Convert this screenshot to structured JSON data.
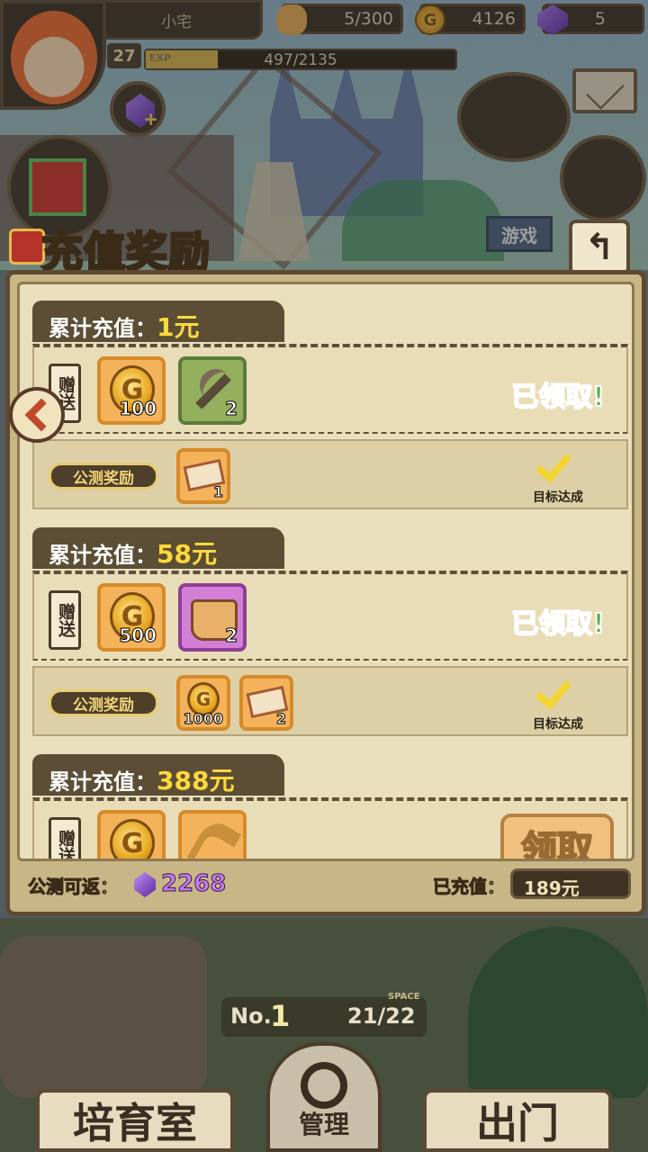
{
  "hud": {
    "player_name": "小宅",
    "level": "27",
    "exp_label": "EXP",
    "exp_text": "497/2135",
    "exp_progress": 0.233,
    "bread": {
      "icon": "bread-icon",
      "value": "5/300"
    },
    "gold": {
      "icon": "gold-coin-icon",
      "value": "4126"
    },
    "gems": {
      "icon": "purple-gem-icon",
      "value": "5"
    },
    "game_tag": "游戏"
  },
  "title": "充值奖励",
  "back_label": "↰",
  "labels": {
    "gift": "赠送",
    "beta_reward": "公测奖励",
    "claimed": "已领取!",
    "target_reached": "目标达成",
    "claim_button": "领取",
    "coin_glyph": "G"
  },
  "tiers": [
    {
      "prefix": "累计充值：",
      "amount": "1元",
      "gifts": [
        {
          "icon": "gold-coin-icon",
          "qty": "100",
          "frame": "orange"
        },
        {
          "icon": "pickaxe-icon",
          "qty": "2",
          "frame": "green"
        }
      ],
      "beta": [
        {
          "icon": "ticket-icon",
          "qty": "1",
          "frame": "orange"
        }
      ],
      "status": "claimed"
    },
    {
      "prefix": "累计充值：",
      "amount": "58元",
      "gifts": [
        {
          "icon": "gold-coin-icon",
          "qty": "500",
          "frame": "orange"
        },
        {
          "icon": "bread-basket-icon",
          "qty": "2",
          "frame": "purple"
        }
      ],
      "beta": [
        {
          "icon": "gold-coin-icon",
          "qty": "1000",
          "frame": "orange"
        },
        {
          "icon": "ticket-icon",
          "qty": "2",
          "frame": "orange"
        }
      ],
      "status": "claimed"
    },
    {
      "prefix": "累计充值：",
      "amount": "388元",
      "gifts": [
        {
          "icon": "gold-coin-icon",
          "qty": "",
          "frame": "orange"
        },
        {
          "icon": "key-icon",
          "qty": "",
          "frame": "orange"
        }
      ],
      "status": "claimable"
    }
  ],
  "footer": {
    "beta_return_label": "公测可返：",
    "beta_return_value": "2268",
    "recharged_label": "已充值：",
    "recharged_value": "189元"
  },
  "bottom_nav": {
    "no_label": "No.",
    "no_value": "1",
    "space_value": "21/22",
    "space_label": "SPACE",
    "left": "培育室",
    "middle": "管理",
    "right": "出门"
  }
}
